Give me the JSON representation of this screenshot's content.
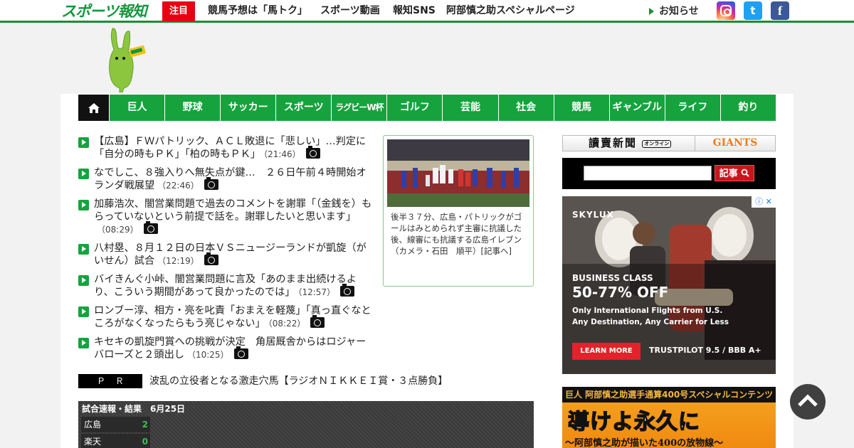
{
  "header": {
    "logo": "スポーツ報知",
    "attention": "注目",
    "links": [
      "競馬予想は「馬トク」",
      "スポーツ動画",
      "報知SNS",
      "阿部慎之助スペシャルページ"
    ],
    "notice": "お知らせ",
    "social": [
      {
        "name": "instagram-icon",
        "color": "#d6249f"
      },
      {
        "name": "twitter-icon",
        "color": "#1da1f2",
        "glyph": "t"
      },
      {
        "name": "facebook-icon",
        "color": "#3b5998",
        "glyph": "f"
      }
    ]
  },
  "nav": {
    "home_icon": "home-icon",
    "items": [
      "巨人",
      "野球",
      "サッカー",
      "スポーツ",
      "ラグビーW杯",
      "ゴルフ",
      "芸能",
      "社会",
      "競馬",
      "ギャンブル",
      "ライフ",
      "釣り"
    ]
  },
  "news": [
    {
      "title": "【広島】ＦＷパトリック、ＡＣＬ敗退に「悲しい」…判定に「自分の時もＰＫ」「柏の時もＰＫ」",
      "time": "（21:46）"
    },
    {
      "title": "なでしこ、８強入りへ無失点が鍵…　２６日午前４時開始オランダ戦展望",
      "time": "（22:46）"
    },
    {
      "title": "加藤浩次、闇営業問題で過去のコメントを謝罪「（金銭を）もらっていないという前提で話を。謝罪したいと思います」",
      "time": "（08:29）"
    },
    {
      "title": "八村塁、８月１２日の日本ＶＳニュージーランドが凱旋（がいせん）試合",
      "time": "（12:19）"
    },
    {
      "title": "バイきんぐ小峠、闇営業問題に言及「あのまま出続けるより、こういう期間があって良かったのでは」",
      "time": "（12:57）"
    },
    {
      "title": "ロンブー淳、相方・亮を叱責「おまえを軽蔑」「真っ直ぐなところがなくなったらもう亮じゃない」",
      "time": "（08:22）"
    },
    {
      "title": "キセキの凱旋門賞への挑戦が決定　角居厩舎からはロジャーバローズと２頭出し",
      "time": "（10:25）"
    }
  ],
  "photo": {
    "caption": "後半３７分、広島・パトリックがゴールはみとめられず主審に抗議した後、線審にも抗議する広島イレブン（カメラ・石田　順平）[記事へ]"
  },
  "pr": {
    "label": "ＰＲ",
    "text": "波乱の立役者となる激走穴馬【ラジオＮＩＫＫＥＩ賞・３点勝負】"
  },
  "scores": {
    "title": "試合速報・結果",
    "date": "6月25日",
    "rows": [
      {
        "team": "広島",
        "score": "2"
      },
      {
        "team": "楽天",
        "score": "0"
      }
    ]
  },
  "sidebar": {
    "yomiuri": "讀賣新聞",
    "yomiuri_tag": "オンライン",
    "giants": "GIANTS",
    "search_button": "記事",
    "ad": {
      "brand": "SKYLUX",
      "class": "BUSINESS CLASS",
      "offer": "50-77% OFF",
      "line1": "Only International Flights from U.S.",
      "line2": "Any Destination, Any Carrier for Less",
      "button": "LEARN MORE",
      "trust": "TRUSTPILOT 9.5 / BBB A+"
    },
    "giants_banner": {
      "top": "巨人 阿部慎之助選手通算400号スペシャルコンテンツ",
      "main": "導けよ永久に",
      "sub": "～阿部慎之助が描いた400の放物線～"
    }
  }
}
